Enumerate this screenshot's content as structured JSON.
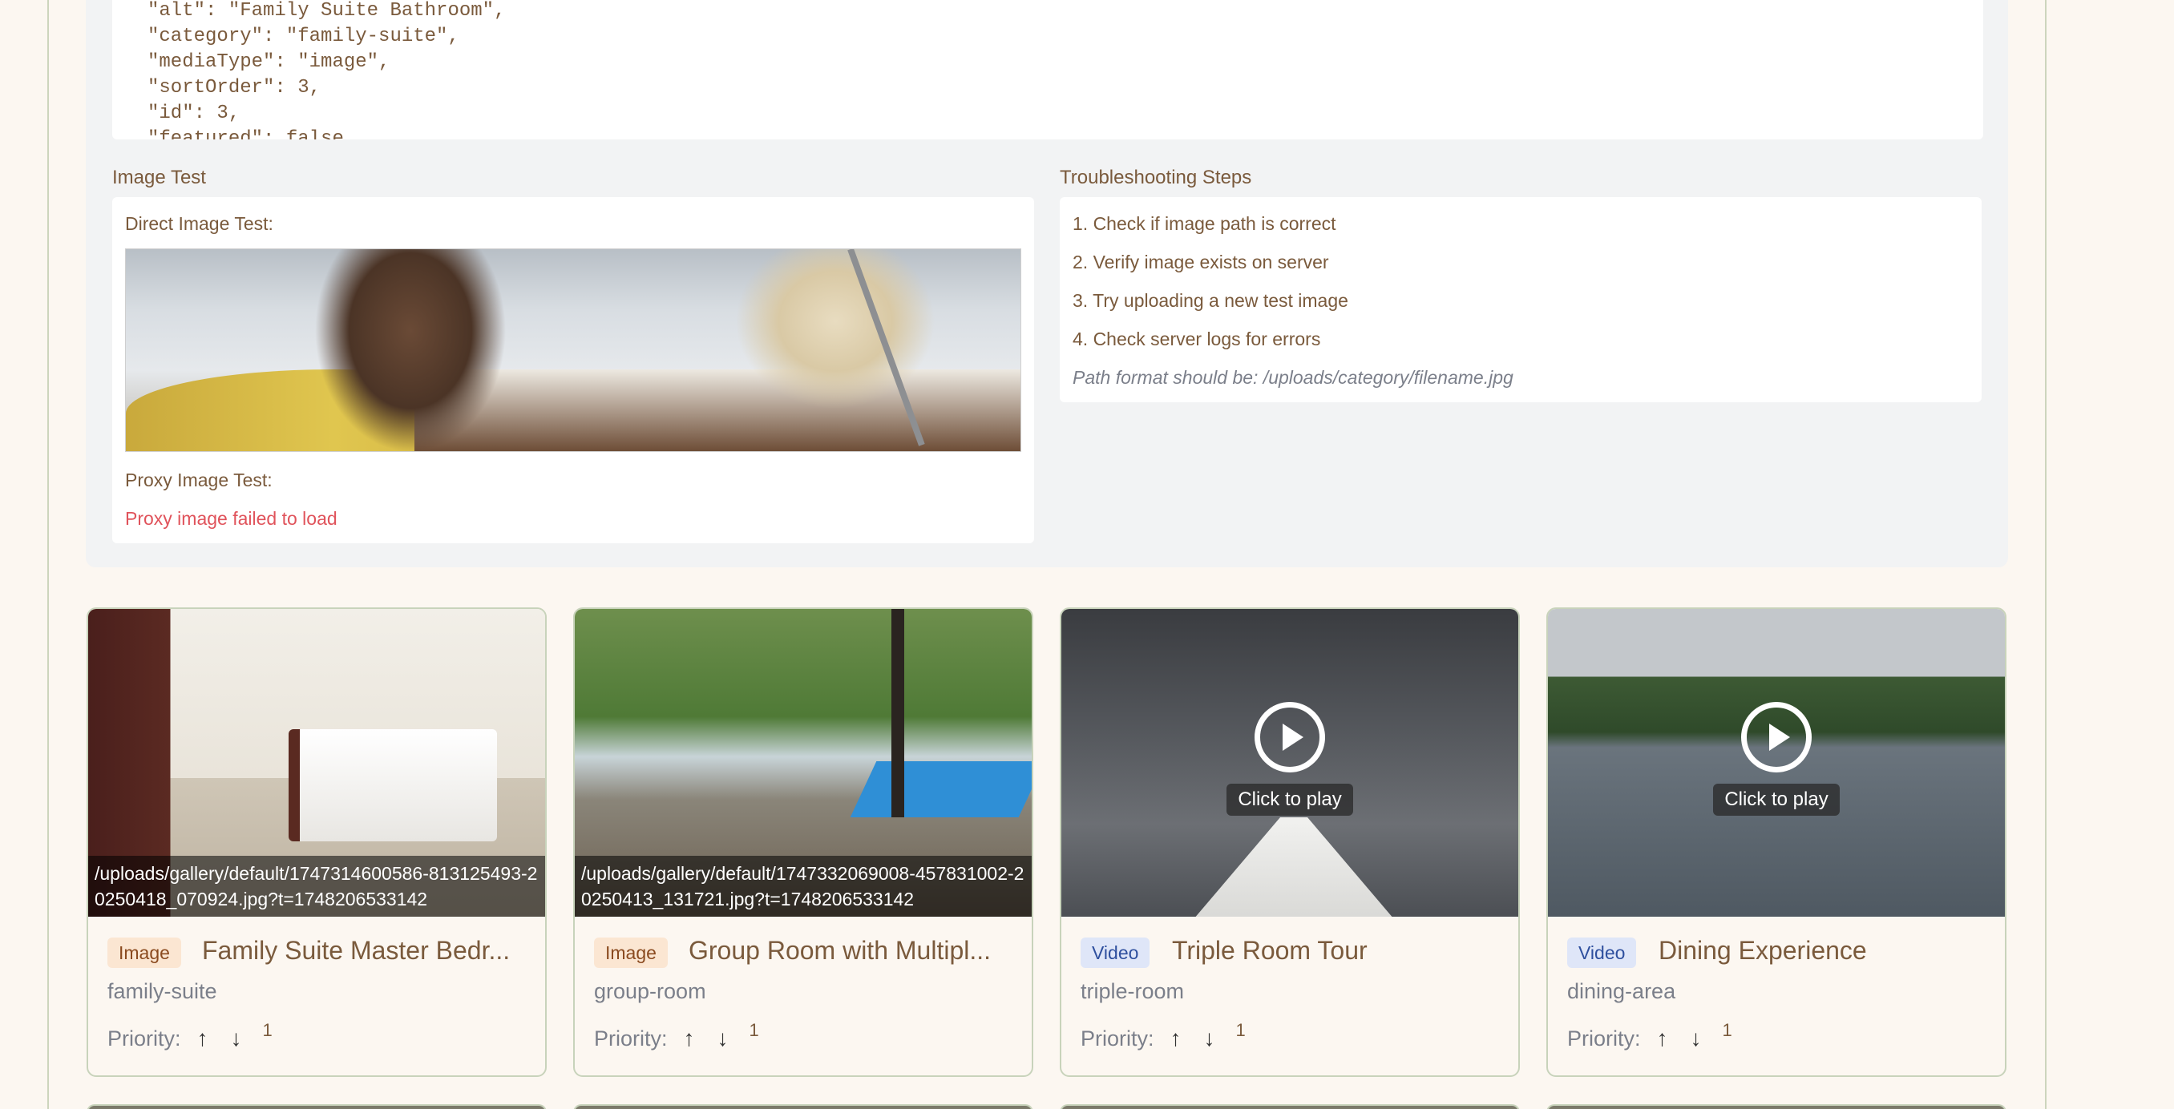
{
  "json_preview": [
    "\"alt\": \"Family Suite Bathroom\",",
    "\"category\": \"family-suite\",",
    "\"mediaType\": \"image\",",
    "\"sortOrder\": 3,",
    "\"id\": 3,",
    "\"featured\": false"
  ],
  "image_test": {
    "heading": "Image Test",
    "direct_label": "Direct Image Test:",
    "proxy_label": "Proxy Image Test:",
    "proxy_error": "Proxy image failed to load"
  },
  "troubleshooting": {
    "heading": "Troubleshooting Steps",
    "steps": [
      "1. Check if image path is correct",
      "2. Verify image exists on server",
      "3. Try uploading a new test image",
      "4. Check server logs for errors"
    ],
    "note": "Path format should be: /uploads/category/filename.jpg"
  },
  "cards": [
    {
      "type_badge": "Image",
      "title": "Family Suite Master Bedr...",
      "category": "family-suite",
      "priority_label": "Priority:",
      "priority_value": "1",
      "path_overlay": "/uploads/gallery/default/1747314600586-813125493-20250418_070924.jpg?t=1748206533142"
    },
    {
      "type_badge": "Image",
      "title": "Group Room with Multipl...",
      "category": "group-room",
      "priority_label": "Priority:",
      "priority_value": "1",
      "path_overlay": "/uploads/gallery/default/1747332069008-457831002-20250413_131721.jpg?t=1748206533142"
    },
    {
      "type_badge": "Video",
      "title": "Triple Room Tour",
      "category": "triple-room",
      "priority_label": "Priority:",
      "priority_value": "1",
      "play_label": "Click to play"
    },
    {
      "type_badge": "Video",
      "title": "Dining Experience",
      "category": "dining-area",
      "priority_label": "Priority:",
      "priority_value": "1",
      "play_label": "Click to play"
    }
  ],
  "icons": {
    "move_up": "arrow-up-icon",
    "move_down": "arrow-down-icon",
    "play": "play-icon"
  },
  "colors": {
    "page_bg": "#fcf7f1",
    "text_brown": "#7a5a3c",
    "error_red": "#e0535b",
    "image_badge_bg": "#fbe6d2",
    "video_badge_bg": "#dfe6f8",
    "card_border": "#c8d3bb"
  }
}
